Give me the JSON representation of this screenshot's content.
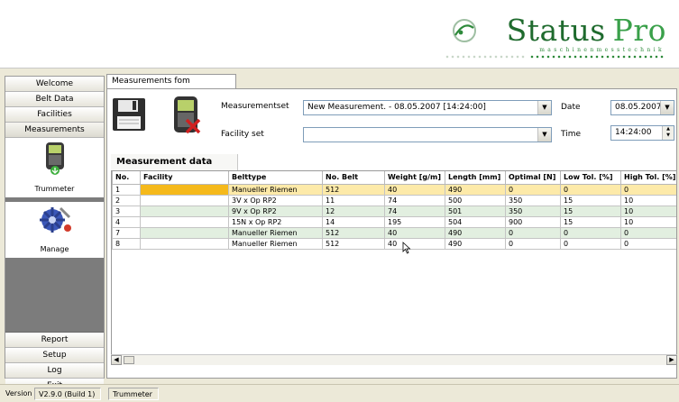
{
  "brand": {
    "word": "Status",
    "word2": "Pro",
    "tagline": "maschinenmesstechnik"
  },
  "nav": {
    "top": [
      "Welcome",
      "Belt Data",
      "Facilities",
      "Measurements"
    ],
    "tools": [
      {
        "label": "Trummeter",
        "icon": "trummeter-device-icon"
      },
      {
        "label": "Manage",
        "icon": "gear-globe-icon"
      }
    ],
    "bottom": [
      "Report",
      "Setup",
      "Log",
      "Exit"
    ]
  },
  "status": {
    "version_label": "Version",
    "version_value": "V2.9.0 (Build 1)",
    "module": "Trummeter"
  },
  "panel": {
    "tab": "Measurements fom Trummeter",
    "measurementset_label": "Measurementset",
    "measurementset_value": "New Measurement. - 08.05.2007 [14:24:00]",
    "facility_label": "Facility set",
    "facility_value": "",
    "date_label": "Date",
    "date_value": "08.05.2007",
    "time_label": "Time",
    "time_value": "14:24:00",
    "section": "Measurement data"
  },
  "table": {
    "columns": [
      "No.",
      "Facility",
      "Belttype",
      "No. Belt",
      "Weight [g/m]",
      "Length [mm]",
      "Optimal [N]",
      "Low Tol. [%]",
      "High Tol. [%]"
    ],
    "rows": [
      [
        "1",
        "",
        "Manueller Riemen",
        "512",
        "40",
        "490",
        "0",
        "0",
        "0"
      ],
      [
        "2",
        "",
        "3V x Op RP2",
        "11",
        "74",
        "500",
        "350",
        "15",
        "10"
      ],
      [
        "3",
        "",
        "9V x Op RP2",
        "12",
        "74",
        "501",
        "350",
        "15",
        "10"
      ],
      [
        "4",
        "",
        "15N x Op RP2",
        "14",
        "195",
        "504",
        "900",
        "15",
        "10"
      ],
      [
        "7",
        "",
        "Manueller Riemen",
        "512",
        "40",
        "490",
        "0",
        "0",
        "0"
      ],
      [
        "8",
        "",
        "Manueller Riemen",
        "512",
        "40",
        "490",
        "0",
        "0",
        "0"
      ]
    ]
  },
  "colors": {
    "brand_green": "#1f6b2e",
    "selected_row": "#fdeaa9",
    "selected_cell": "#f5b91b",
    "alt_row": "#e2efe0"
  }
}
